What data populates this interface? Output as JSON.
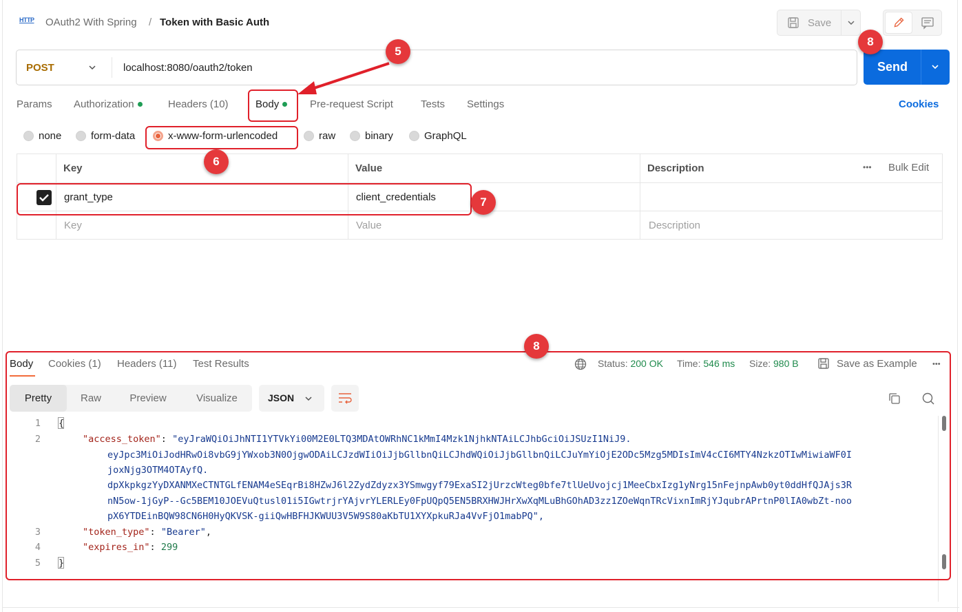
{
  "breadcrumb": {
    "icon": "HTTP",
    "parent": "OAuth2 With Spring",
    "separator": "/",
    "current": "Token with Basic Auth"
  },
  "toolbar": {
    "save_label": "Save"
  },
  "request": {
    "method": "POST",
    "url": "localhost:8080/oauth2/token",
    "send_label": "Send"
  },
  "request_tabs": [
    {
      "label": "Params"
    },
    {
      "label": "Authorization",
      "dot": true
    },
    {
      "label": "Headers",
      "count": "(10)"
    },
    {
      "label": "Body",
      "dot": true,
      "active": true
    },
    {
      "label": "Pre-request Script"
    },
    {
      "label": "Tests"
    },
    {
      "label": "Settings"
    }
  ],
  "cookies_link": "Cookies",
  "body_types": [
    {
      "label": "none"
    },
    {
      "label": "form-data"
    },
    {
      "label": "x-www-form-urlencoded",
      "selected": true
    },
    {
      "label": "raw"
    },
    {
      "label": "binary"
    },
    {
      "label": "GraphQL"
    }
  ],
  "params_table": {
    "headers": {
      "key": "Key",
      "value": "Value",
      "description": "Description",
      "bulk_edit": "Bulk Edit",
      "more": "•••"
    },
    "rows": [
      {
        "checked": true,
        "key": "grant_type",
        "value": "client_credentials",
        "description": ""
      }
    ],
    "placeholder": {
      "key": "Key",
      "value": "Value",
      "description": "Description"
    }
  },
  "annotations": {
    "badge_5": "5",
    "badge_6": "6",
    "badge_7": "7",
    "badge_8_send": "8",
    "badge_8_response": "8",
    "accent_color": "#e0202a"
  },
  "response": {
    "tabs": [
      {
        "label": "Body",
        "active": true
      },
      {
        "label": "Cookies",
        "count": "(1)"
      },
      {
        "label": "Headers",
        "count": "(11)"
      },
      {
        "label": "Test Results"
      }
    ],
    "status_label": "Status:",
    "status_value": "200 OK",
    "time_label": "Time:",
    "time_value": "546 ms",
    "size_label": "Size:",
    "size_value": "980 B",
    "save_example": "Save as Example",
    "more": "•••",
    "format_buttons": [
      "Pretty",
      "Raw",
      "Preview",
      "Visualize"
    ],
    "format_selected": "JSON",
    "code": {
      "line_numbers": [
        "1",
        "2",
        "3",
        "4",
        "5"
      ],
      "open_brace": "{",
      "close_brace": "}",
      "access_token_key": "\"access_token\"",
      "access_token_value_lines": [
        "\"eyJraWQiOiJhNTI1YTVkYi00M2E0LTQ3MDAtOWRhNC1kMmI4Mzk1NjhkNTAiLCJhbGciOiJSUzI1NiJ9.",
        "eyJpc3MiOiJodHRwOi8vbG9jYWxob3N0OjgwODAiLCJzdWIiOiJjbGllbnQiLCJhdWQiOiJjbGllbnQiLCJuYmYiOjE2ODc5Mzg5MDIsImV4cCI6MTY4NzkzOTIwMiwiaWF0I",
        "joxNjg3OTM4OTAyfQ.",
        "dpXkpkgzYyDXANMXeCTNTGLfENAM4eSEqrBi8HZwJ6l2ZydZdyzx3YSmwgyf79ExaSI2jUrzcWteg0bfe7tlUeUvojcj1MeeCbxIzg1yNrg15nFejnpAwb0yt0ddHfQJAjs3R",
        "nN5ow-1jGyP--Gc5BEM10JOEVuQtusl01i5IGwtrjrYAjvrYLERLEy0FpUQpQ5EN5BRXHWJHrXwXqMLuBhGOhAD3zz1ZOeWqnTRcVixnImRjYJqubrAPrtnP0lIA0wbZt-noo",
        "pX6YTDEinBQW98CN6H0HyQKVSK-giiQwHBFHJKWUU3V5W9S80aKbTU1XYXpkuRJa4VvFjO1mabPQ\","
      ],
      "token_type_key": "\"token_type\"",
      "token_type_value": "\"Bearer\"",
      "expires_in_key": "\"expires_in\"",
      "expires_in_value": "299"
    }
  }
}
